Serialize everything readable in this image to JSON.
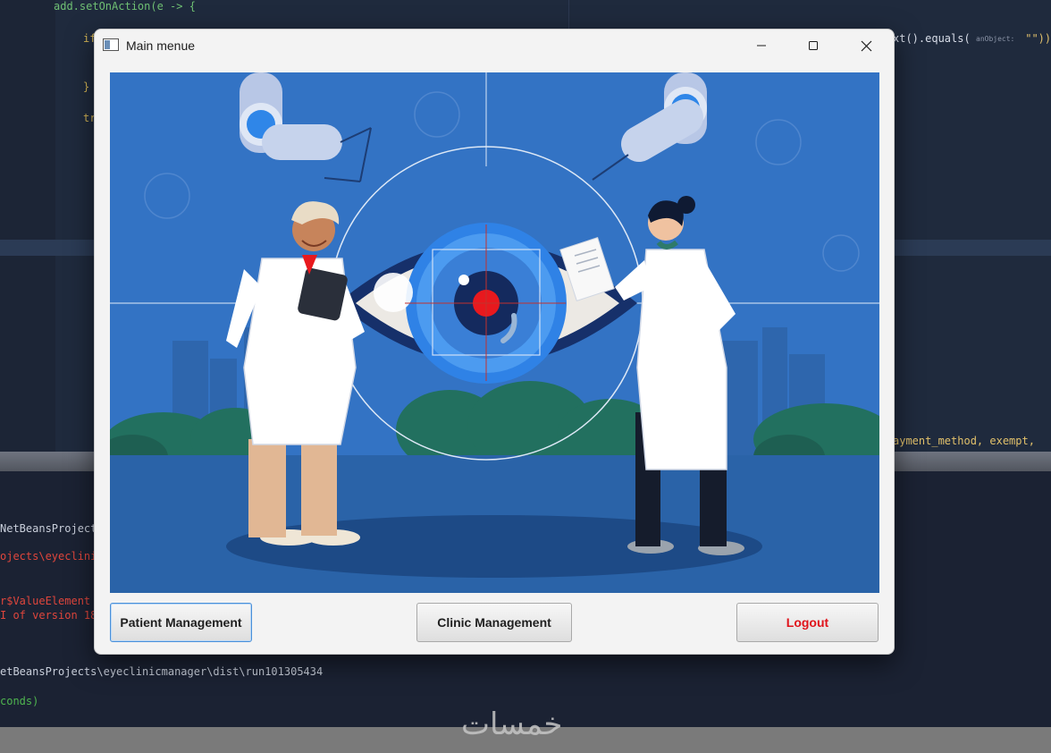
{
  "ide": {
    "code_lines_top": [
      {
        "text": "add.setOnAction(e -> {"
      },
      {
        "text": "if"
      },
      {
        "text": "}"
      },
      {
        "text": "tr"
      },
      {
        "text": "xt().equals("
      },
      {
        "text": "anObject:"
      },
      {
        "text": " \"\"))"
      },
      {
        "text": "ayment_method, exempt,"
      }
    ],
    "console_lines": [
      {
        "text": "NetBeansProject",
        "color": "#c9cfdb"
      },
      {
        "text": "ojects\\eyeclinic",
        "color": "#e0463c"
      },
      {
        "text": "r$ValueElement ",
        "color": "#e0463c"
      },
      {
        "text": "I of version 18",
        "color": "#e0463c"
      },
      {
        "text": "etBeansProjects\\eyeclinicmanager\\dist\\run101305434",
        "color": "#c9cfdb"
      },
      {
        "text": "conds)",
        "color": "#4fb54f"
      }
    ],
    "watermark": "خمسات"
  },
  "window": {
    "title": "Main menue",
    "controls": {
      "minimize_icon": "minimize-icon",
      "maximize_icon": "maximize-icon",
      "close_icon": "close-icon"
    }
  },
  "buttons": {
    "patient_label": "Patient Management",
    "clinic_label": "Clinic Management",
    "logout_label": "Logout"
  },
  "colors": {
    "illustration_bg": "#3373c4",
    "logout_text": "#e0131b",
    "focus_border": "#4a90d9"
  }
}
